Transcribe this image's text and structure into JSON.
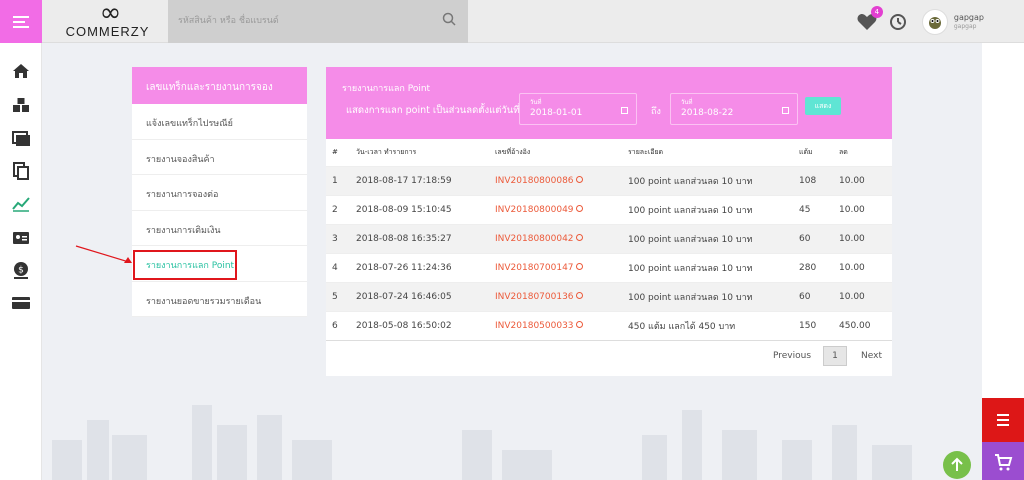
{
  "header": {
    "logo_text": "COMMERZY",
    "search_placeholder": "รหัสสินค้า หรือ ชื่อแบรนด์",
    "wishlist_count": "4",
    "user_name": "gapgap",
    "user_sub": "gapgap"
  },
  "sidebar": {
    "title": "เลขแทร็กและรายงานการจอง",
    "items": [
      {
        "label": "แจ้งเลขแทร็กไปรษณีย์"
      },
      {
        "label": "รายงานจองสินค้า"
      },
      {
        "label": "รายงานการจองต่อ"
      },
      {
        "label": "รายงานการเติมเงิน"
      },
      {
        "label": "รายงานการแลก Point"
      },
      {
        "label": "รายงานยอดขายรวมรายเดือน"
      }
    ]
  },
  "main": {
    "title": "รายงานการแลก Point",
    "filter_label": "แสดงการแลก point เป็นส่วนลดตั้งแต่วันที่",
    "date_from_label": "วันที่",
    "date_from": "2018-01-01",
    "to_label": "ถึง",
    "date_to_label": "วันที่",
    "date_to": "2018-08-22",
    "show_button": "แสดง",
    "columns": [
      "#",
      "วัน-เวลา ทำรายการ",
      "เลขที่อ้างอิง",
      "รายละเอียด",
      "แต้ม",
      "ลด"
    ],
    "rows": [
      {
        "no": "1",
        "datetime": "2018-08-17 17:18:59",
        "ref": "INV20180800086",
        "detail": "100 point แลกส่วนลด 10 บาท",
        "points": "108",
        "discount": "10.00"
      },
      {
        "no": "2",
        "datetime": "2018-08-09 15:10:45",
        "ref": "INV20180800049",
        "detail": "100 point แลกส่วนลด 10 บาท",
        "points": "45",
        "discount": "10.00"
      },
      {
        "no": "3",
        "datetime": "2018-08-08 16:35:27",
        "ref": "INV20180800042",
        "detail": "100 point แลกส่วนลด 10 บาท",
        "points": "60",
        "discount": "10.00"
      },
      {
        "no": "4",
        "datetime": "2018-07-26 11:24:36",
        "ref": "INV20180700147",
        "detail": "100 point แลกส่วนลด 10 บาท",
        "points": "280",
        "discount": "10.00"
      },
      {
        "no": "5",
        "datetime": "2018-07-24 16:46:05",
        "ref": "INV20180700136",
        "detail": "100 point แลกส่วนลด 10 บาท",
        "points": "60",
        "discount": "10.00"
      },
      {
        "no": "6",
        "datetime": "2018-05-08 16:50:02",
        "ref": "INV20180500033",
        "detail": "450 แต้ม แลกได้ 450 บาท",
        "points": "150",
        "discount": "450.00"
      }
    ],
    "pager": {
      "previous": "Previous",
      "current": "1",
      "next": "Next"
    }
  },
  "colors": {
    "accent": "#f58ce8",
    "accent_dark": "#f26ce6",
    "link": "#ec5a3a",
    "active": "#27c1a0"
  }
}
